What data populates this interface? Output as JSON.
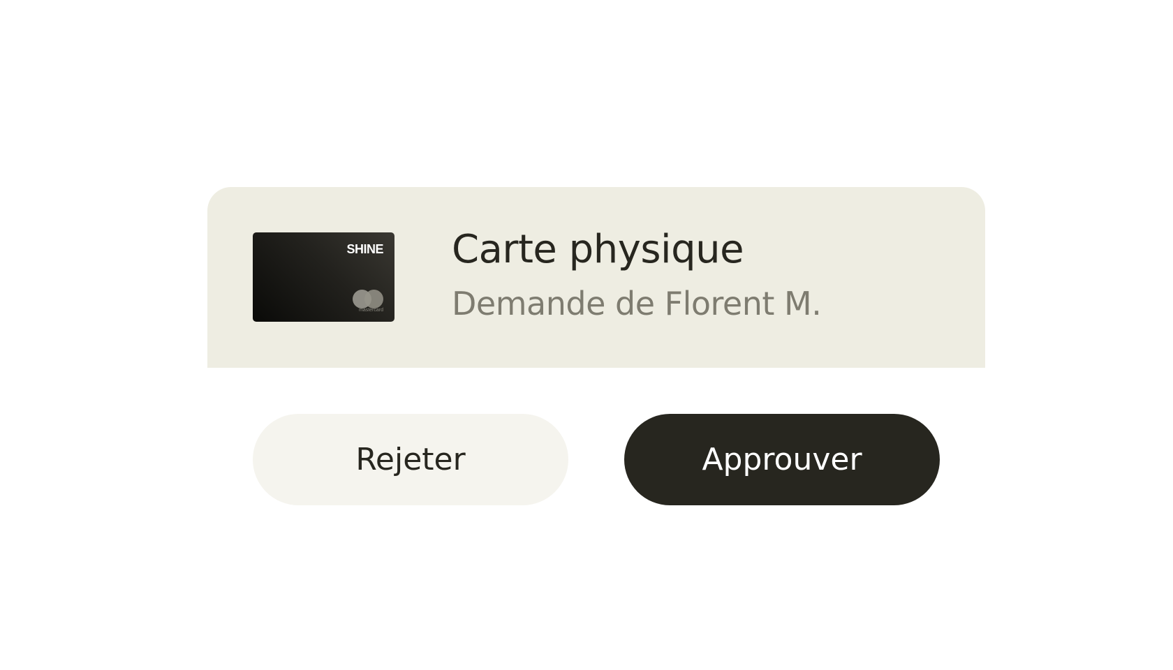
{
  "request": {
    "card_brand": "SHINE",
    "card_network": "mastercard",
    "title": "Carte physique",
    "subtitle": "Demande de Florent M."
  },
  "actions": {
    "reject_label": "Rejeter",
    "approve_label": "Approuver"
  },
  "colors": {
    "panel_background": "#eeede2",
    "primary_button": "#27261f",
    "secondary_button": "#f5f4ee",
    "title_text": "#27261f",
    "subtitle_text": "#7e7c70"
  },
  "icons": {
    "card": "credit-card-icon",
    "network": "mastercard-logo-icon"
  }
}
